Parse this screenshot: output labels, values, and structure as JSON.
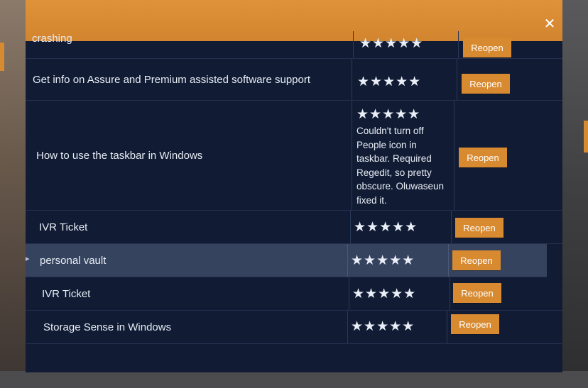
{
  "dialog": {
    "close_glyph": "✕",
    "header_color": "#d88a31"
  },
  "feedback_rows": [
    {
      "title": "crashing",
      "rating": 5,
      "stars": "★★★★★",
      "comment": "",
      "button_label": "Reopen"
    },
    {
      "title": "Get info on Assure and Premium assisted software support",
      "rating": 5,
      "stars": "★★★★★",
      "comment": "",
      "button_label": "Reopen"
    },
    {
      "title": "How to use the taskbar in Windows",
      "rating": 5,
      "stars": "★★★★★",
      "comment": "Couldn't turn off People icon in taskbar. Required Regedit, so pretty obscure. Oluwaseun fixed it.",
      "button_label": "Reopen"
    },
    {
      "title": "IVR Ticket",
      "rating": 5,
      "stars": "★★★★★",
      "comment": "",
      "button_label": "Reopen"
    },
    {
      "title": "personal vault",
      "rating": 5,
      "stars": "★★★★★",
      "comment": "",
      "button_label": "Reopen",
      "selected": true
    },
    {
      "title": "IVR Ticket",
      "rating": 5,
      "stars": "★★★★★",
      "comment": "",
      "button_label": "Reopen"
    },
    {
      "title": "Storage Sense in Windows",
      "rating": 5,
      "stars": "★★★★★",
      "comment": "",
      "button_label": "Reopen"
    }
  ]
}
